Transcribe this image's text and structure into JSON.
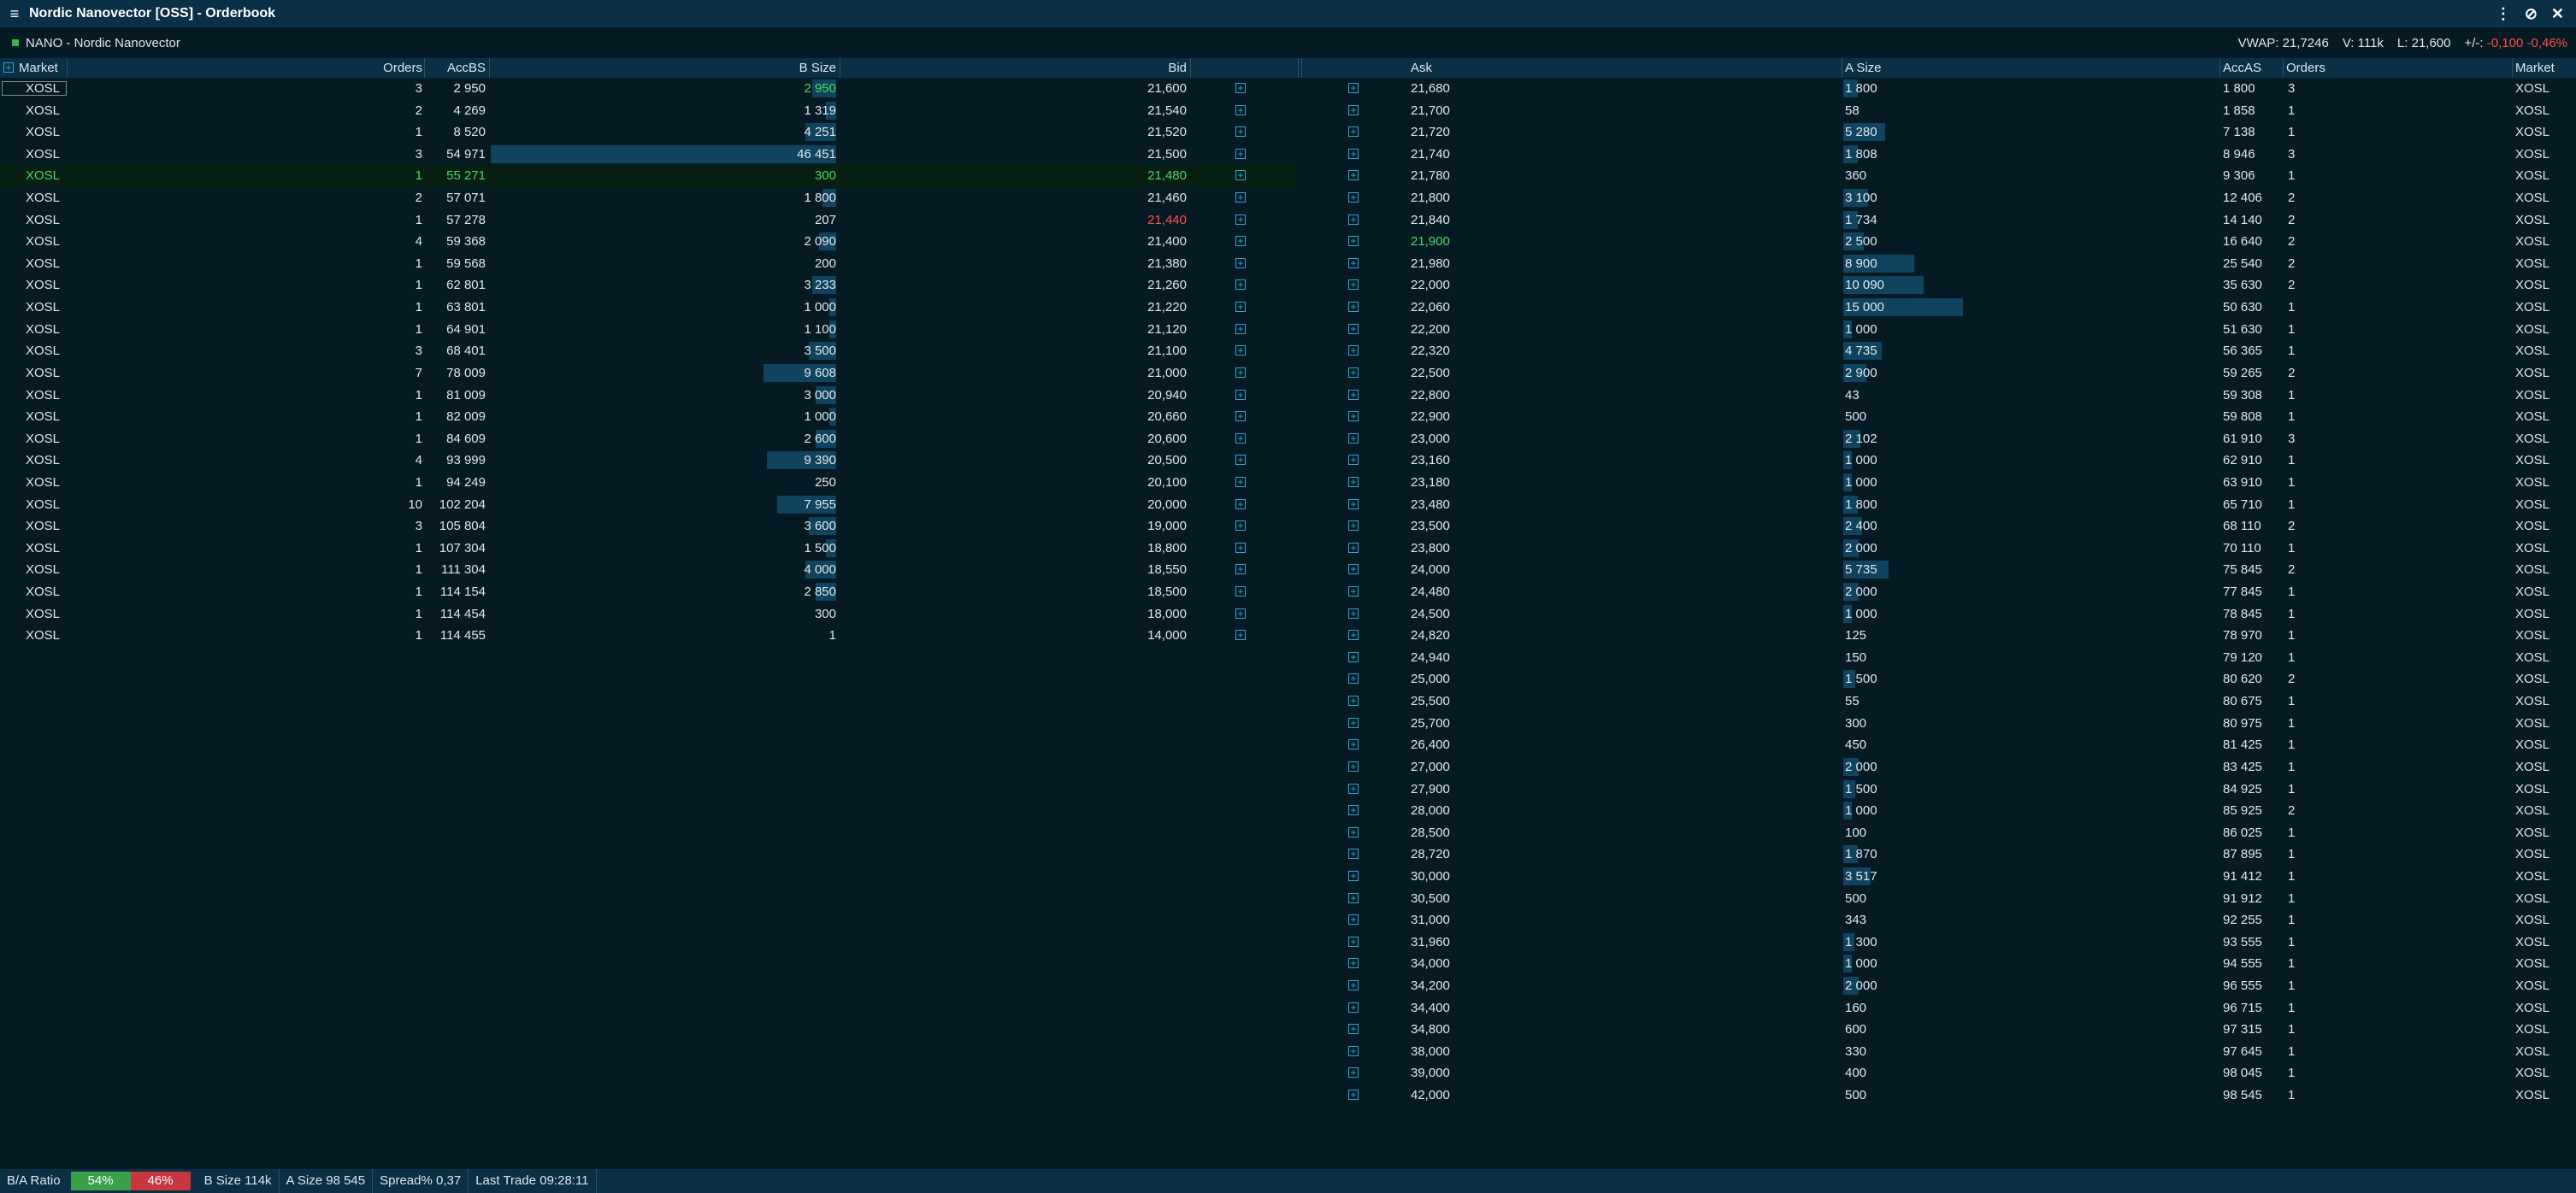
{
  "window": {
    "title": "Nordic Nanovector [OSS] - Orderbook"
  },
  "instrument": {
    "name": "NANO - Nordic Nanovector",
    "vwap": "VWAP: 21,7246",
    "volume": "V: 111k",
    "last": "L: 21,600",
    "change_label": "+/-:",
    "change": "-0,100",
    "change_pct": "-0,46%"
  },
  "columns": {
    "market": "Market",
    "orders": "Orders",
    "accbs": "AccBS",
    "bsize": "B Size",
    "bid": "Bid",
    "ask": "Ask",
    "asize": "A Size",
    "accas": "AccAS",
    "orders_r": "Orders",
    "market_r": "Market"
  },
  "bids": [
    {
      "market": "XOSL",
      "orders": "3",
      "acc": "2 950",
      "size": "2 950",
      "price": "21,600",
      "bar": 0.07
    },
    {
      "market": "XOSL",
      "orders": "2",
      "acc": "4 269",
      "size": "1 319",
      "price": "21,540",
      "bar": 0.03
    },
    {
      "market": "XOSL",
      "orders": "1",
      "acc": "8 520",
      "size": "4 251",
      "price": "21,520",
      "bar": 0.09
    },
    {
      "market": "XOSL",
      "orders": "3",
      "acc": "54 971",
      "size": "46 451",
      "price": "21,500",
      "bar": 1.0
    },
    {
      "market": "XOSL",
      "orders": "1",
      "acc": "55 271",
      "size": "300",
      "price": "21,480",
      "bar": 0
    },
    {
      "market": "XOSL",
      "orders": "2",
      "acc": "57 071",
      "size": "1 800",
      "price": "21,460",
      "bar": 0.04
    },
    {
      "market": "XOSL",
      "orders": "1",
      "acc": "57 278",
      "size": "207",
      "price": "21,440",
      "bar": 0
    },
    {
      "market": "XOSL",
      "orders": "4",
      "acc": "59 368",
      "size": "2 090",
      "price": "21,400",
      "bar": 0.05
    },
    {
      "market": "XOSL",
      "orders": "1",
      "acc": "59 568",
      "size": "200",
      "price": "21,380",
      "bar": 0
    },
    {
      "market": "XOSL",
      "orders": "1",
      "acc": "62 801",
      "size": "3 233",
      "price": "21,260",
      "bar": 0.07
    },
    {
      "market": "XOSL",
      "orders": "1",
      "acc": "63 801",
      "size": "1 000",
      "price": "21,220",
      "bar": 0.02
    },
    {
      "market": "XOSL",
      "orders": "1",
      "acc": "64 901",
      "size": "1 100",
      "price": "21,120",
      "bar": 0.02
    },
    {
      "market": "XOSL",
      "orders": "3",
      "acc": "68 401",
      "size": "3 500",
      "price": "21,100",
      "bar": 0.08
    },
    {
      "market": "XOSL",
      "orders": "7",
      "acc": "78 009",
      "size": "9 608",
      "price": "21,000",
      "bar": 0.21
    },
    {
      "market": "XOSL",
      "orders": "1",
      "acc": "81 009",
      "size": "3 000",
      "price": "20,940",
      "bar": 0.06
    },
    {
      "market": "XOSL",
      "orders": "1",
      "acc": "82 009",
      "size": "1 000",
      "price": "20,660",
      "bar": 0.02
    },
    {
      "market": "XOSL",
      "orders": "1",
      "acc": "84 609",
      "size": "2 600",
      "price": "20,600",
      "bar": 0.06
    },
    {
      "market": "XOSL",
      "orders": "4",
      "acc": "93 999",
      "size": "9 390",
      "price": "20,500",
      "bar": 0.2
    },
    {
      "market": "XOSL",
      "orders": "1",
      "acc": "94 249",
      "size": "250",
      "price": "20,100",
      "bar": 0
    },
    {
      "market": "XOSL",
      "orders": "10",
      "acc": "102 204",
      "size": "7 955",
      "price": "20,000",
      "bar": 0.17
    },
    {
      "market": "XOSL",
      "orders": "3",
      "acc": "105 804",
      "size": "3 600",
      "price": "19,000",
      "bar": 0.08
    },
    {
      "market": "XOSL",
      "orders": "1",
      "acc": "107 304",
      "size": "1 500",
      "price": "18,800",
      "bar": 0.03
    },
    {
      "market": "XOSL",
      "orders": "1",
      "acc": "111 304",
      "size": "4 000",
      "price": "18,550",
      "bar": 0.09
    },
    {
      "market": "XOSL",
      "orders": "1",
      "acc": "114 154",
      "size": "2 850",
      "price": "18,500",
      "bar": 0.06
    },
    {
      "market": "XOSL",
      "orders": "1",
      "acc": "114 454",
      "size": "300",
      "price": "18,000",
      "bar": 0
    },
    {
      "market": "XOSL",
      "orders": "1",
      "acc": "114 455",
      "size": "1",
      "price": "14,000",
      "bar": 0
    }
  ],
  "asks": [
    {
      "price": "21,680",
      "size": "1 800",
      "acc": "1 800",
      "orders": "3",
      "market": "XOSL",
      "bar": 0.12
    },
    {
      "price": "21,700",
      "size": "58",
      "acc": "1 858",
      "orders": "1",
      "market": "XOSL",
      "bar": 0
    },
    {
      "price": "21,720",
      "size": "5 280",
      "acc": "7 138",
      "orders": "1",
      "market": "XOSL",
      "bar": 0.35
    },
    {
      "price": "21,740",
      "size": "1 808",
      "acc": "8 946",
      "orders": "3",
      "market": "XOSL",
      "bar": 0.12
    },
    {
      "price": "21,780",
      "size": "360",
      "acc": "9 306",
      "orders": "1",
      "market": "XOSL",
      "bar": 0
    },
    {
      "price": "21,800",
      "size": "3 100",
      "acc": "12 406",
      "orders": "2",
      "market": "XOSL",
      "bar": 0.21
    },
    {
      "price": "21,840",
      "size": "1 734",
      "acc": "14 140",
      "orders": "2",
      "market": "XOSL",
      "bar": 0.12
    },
    {
      "price": "21,900",
      "size": "2 500",
      "acc": "16 640",
      "orders": "2",
      "market": "XOSL",
      "bar": 0.17
    },
    {
      "price": "21,980",
      "size": "8 900",
      "acc": "25 540",
      "orders": "2",
      "market": "XOSL",
      "bar": 0.59
    },
    {
      "price": "22,000",
      "size": "10 090",
      "acc": "35 630",
      "orders": "2",
      "market": "XOSL",
      "bar": 0.67
    },
    {
      "price": "22,060",
      "size": "15 000",
      "acc": "50 630",
      "orders": "1",
      "market": "XOSL",
      "bar": 1.0
    },
    {
      "price": "22,200",
      "size": "1 000",
      "acc": "51 630",
      "orders": "1",
      "market": "XOSL",
      "bar": 0.07
    },
    {
      "price": "22,320",
      "size": "4 735",
      "acc": "56 365",
      "orders": "1",
      "market": "XOSL",
      "bar": 0.32
    },
    {
      "price": "22,500",
      "size": "2 900",
      "acc": "59 265",
      "orders": "2",
      "market": "XOSL",
      "bar": 0.19
    },
    {
      "price": "22,800",
      "size": "43",
      "acc": "59 308",
      "orders": "1",
      "market": "XOSL",
      "bar": 0
    },
    {
      "price": "22,900",
      "size": "500",
      "acc": "59 808",
      "orders": "1",
      "market": "XOSL",
      "bar": 0
    },
    {
      "price": "23,000",
      "size": "2 102",
      "acc": "61 910",
      "orders": "3",
      "market": "XOSL",
      "bar": 0.14
    },
    {
      "price": "23,160",
      "size": "1 000",
      "acc": "62 910",
      "orders": "1",
      "market": "XOSL",
      "bar": 0.07
    },
    {
      "price": "23,180",
      "size": "1 000",
      "acc": "63 910",
      "orders": "1",
      "market": "XOSL",
      "bar": 0.07
    },
    {
      "price": "23,480",
      "size": "1 800",
      "acc": "65 710",
      "orders": "1",
      "market": "XOSL",
      "bar": 0.12
    },
    {
      "price": "23,500",
      "size": "2 400",
      "acc": "68 110",
      "orders": "2",
      "market": "XOSL",
      "bar": 0.16
    },
    {
      "price": "23,800",
      "size": "2 000",
      "acc": "70 110",
      "orders": "1",
      "market": "XOSL",
      "bar": 0.13
    },
    {
      "price": "24,000",
      "size": "5 735",
      "acc": "75 845",
      "orders": "2",
      "market": "XOSL",
      "bar": 0.38
    },
    {
      "price": "24,480",
      "size": "2 000",
      "acc": "77 845",
      "orders": "1",
      "market": "XOSL",
      "bar": 0.13
    },
    {
      "price": "24,500",
      "size": "1 000",
      "acc": "78 845",
      "orders": "1",
      "market": "XOSL",
      "bar": 0.07
    },
    {
      "price": "24,820",
      "size": "125",
      "acc": "78 970",
      "orders": "1",
      "market": "XOSL",
      "bar": 0
    },
    {
      "price": "24,940",
      "size": "150",
      "acc": "79 120",
      "orders": "1",
      "market": "XOSL",
      "bar": 0
    },
    {
      "price": "25,000",
      "size": "1 500",
      "acc": "80 620",
      "orders": "2",
      "market": "XOSL",
      "bar": 0.1
    },
    {
      "price": "25,500",
      "size": "55",
      "acc": "80 675",
      "orders": "1",
      "market": "XOSL",
      "bar": 0
    },
    {
      "price": "25,700",
      "size": "300",
      "acc": "80 975",
      "orders": "1",
      "market": "XOSL",
      "bar": 0
    },
    {
      "price": "26,400",
      "size": "450",
      "acc": "81 425",
      "orders": "1",
      "market": "XOSL",
      "bar": 0
    },
    {
      "price": "27,000",
      "size": "2 000",
      "acc": "83 425",
      "orders": "1",
      "market": "XOSL",
      "bar": 0.13
    },
    {
      "price": "27,900",
      "size": "1 500",
      "acc": "84 925",
      "orders": "1",
      "market": "XOSL",
      "bar": 0.1
    },
    {
      "price": "28,000",
      "size": "1 000",
      "acc": "85 925",
      "orders": "2",
      "market": "XOSL",
      "bar": 0.07
    },
    {
      "price": "28,500",
      "size": "100",
      "acc": "86 025",
      "orders": "1",
      "market": "XOSL",
      "bar": 0
    },
    {
      "price": "28,720",
      "size": "1 870",
      "acc": "87 895",
      "orders": "1",
      "market": "XOSL",
      "bar": 0.12
    },
    {
      "price": "30,000",
      "size": "3 517",
      "acc": "91 412",
      "orders": "1",
      "market": "XOSL",
      "bar": 0.23
    },
    {
      "price": "30,500",
      "size": "500",
      "acc": "91 912",
      "orders": "1",
      "market": "XOSL",
      "bar": 0
    },
    {
      "price": "31,000",
      "size": "343",
      "acc": "92 255",
      "orders": "1",
      "market": "XOSL",
      "bar": 0
    },
    {
      "price": "31,960",
      "size": "1 300",
      "acc": "93 555",
      "orders": "1",
      "market": "XOSL",
      "bar": 0.09
    },
    {
      "price": "34,000",
      "size": "1 000",
      "acc": "94 555",
      "orders": "1",
      "market": "XOSL",
      "bar": 0.07
    },
    {
      "price": "34,200",
      "size": "2 000",
      "acc": "96 555",
      "orders": "1",
      "market": "XOSL",
      "bar": 0.13
    },
    {
      "price": "34,400",
      "size": "160",
      "acc": "96 715",
      "orders": "1",
      "market": "XOSL",
      "bar": 0
    },
    {
      "price": "34,800",
      "size": "600",
      "acc": "97 315",
      "orders": "1",
      "market": "XOSL",
      "bar": 0
    },
    {
      "price": "38,000",
      "size": "330",
      "acc": "97 645",
      "orders": "1",
      "market": "XOSL",
      "bar": 0
    },
    {
      "price": "39,000",
      "size": "400",
      "acc": "98 045",
      "orders": "1",
      "market": "XOSL",
      "bar": 0
    },
    {
      "price": "42,000",
      "size": "500",
      "acc": "98 545",
      "orders": "1",
      "market": "XOSL",
      "bar": 0
    }
  ],
  "highlights": {
    "bid_row": 4,
    "bid_green_size_row": 0,
    "bid_red_price_row": 6,
    "ask_green_price_row": 7
  },
  "status": {
    "ratio_label": "B/A Ratio",
    "bid_pct": "54%",
    "ask_pct": "46%",
    "bsize": "B Size 114k",
    "asize": "A Size 98 545",
    "spread": "Spread% 0,37",
    "last_trade": "Last Trade 09:28:11"
  },
  "colors": {
    "background": "#061a24",
    "header": "#0b2f44",
    "bar": "#10435d",
    "up": "#4cd964",
    "down": "#ff4d4d",
    "bid_ratio": "#3aa04a",
    "ask_ratio": "#c8373d"
  },
  "icons": {
    "menu": "hamburger-icon",
    "more": "more-vertical-icon",
    "link": "unlink-icon",
    "close": "close-icon",
    "expand": "plus-box-icon"
  }
}
